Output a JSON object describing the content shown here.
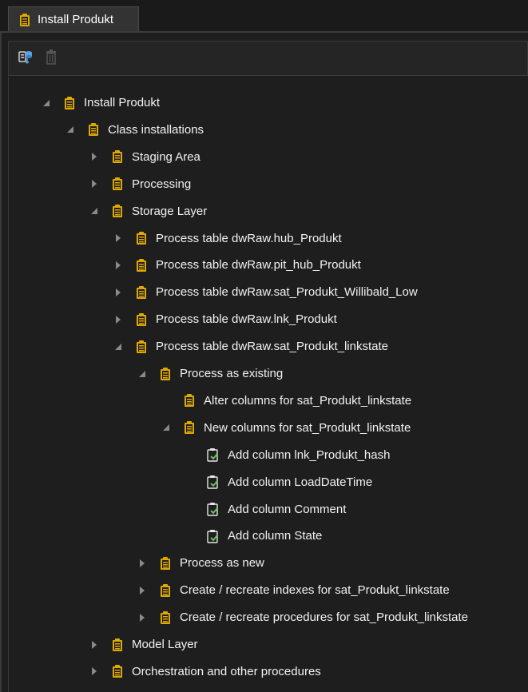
{
  "tab": {
    "title": "Install Produkt"
  },
  "tree": [
    {
      "label": "Install Produkt",
      "level": 0,
      "state": "expanded",
      "icon": "clipboard-icon"
    },
    {
      "label": "Class installations",
      "level": 1,
      "state": "expanded",
      "icon": "clipboard-icon"
    },
    {
      "label": "Staging Area",
      "level": 2,
      "state": "collapsed",
      "icon": "clipboard-icon"
    },
    {
      "label": "Processing",
      "level": 2,
      "state": "collapsed",
      "icon": "clipboard-icon"
    },
    {
      "label": "Storage Layer",
      "level": 2,
      "state": "expanded",
      "icon": "clipboard-icon"
    },
    {
      "label": "Process table dwRaw.hub_Produkt",
      "level": 3,
      "state": "collapsed",
      "icon": "clipboard-icon"
    },
    {
      "label": "Process table dwRaw.pit_hub_Produkt",
      "level": 3,
      "state": "collapsed",
      "icon": "clipboard-icon"
    },
    {
      "label": "Process table dwRaw.sat_Produkt_Willibald_Low",
      "level": 3,
      "state": "collapsed",
      "icon": "clipboard-icon"
    },
    {
      "label": "Process table dwRaw.lnk_Produkt",
      "level": 3,
      "state": "collapsed",
      "icon": "clipboard-icon"
    },
    {
      "label": "Process table dwRaw.sat_Produkt_linkstate",
      "level": 3,
      "state": "expanded",
      "icon": "clipboard-icon"
    },
    {
      "label": "Process as existing",
      "level": 4,
      "state": "expanded",
      "icon": "clipboard-icon"
    },
    {
      "label": "Alter columns for sat_Produkt_linkstate",
      "level": 5,
      "state": "leaf",
      "icon": "clipboard-icon"
    },
    {
      "label": "New columns for sat_Produkt_linkstate",
      "level": 5,
      "state": "expanded",
      "icon": "clipboard-icon"
    },
    {
      "label": "Add column lnk_Produkt_hash",
      "level": 6,
      "state": "leaf",
      "icon": "clipboard-check-icon"
    },
    {
      "label": "Add column LoadDateTime",
      "level": 6,
      "state": "leaf",
      "icon": "clipboard-check-icon"
    },
    {
      "label": "Add column Comment",
      "level": 6,
      "state": "leaf",
      "icon": "clipboard-check-icon"
    },
    {
      "label": "Add column State",
      "level": 6,
      "state": "leaf",
      "icon": "clipboard-check-icon"
    },
    {
      "label": "Process as new",
      "level": 4,
      "state": "collapsed",
      "icon": "clipboard-icon"
    },
    {
      "label": "Create / recreate indexes for sat_Produkt_linkstate",
      "level": 4,
      "state": "collapsed",
      "icon": "clipboard-icon"
    },
    {
      "label": "Create / recreate procedures for sat_Produkt_linkstate",
      "level": 4,
      "state": "collapsed",
      "icon": "clipboard-icon"
    },
    {
      "label": "Model Layer",
      "level": 2,
      "state": "collapsed",
      "icon": "clipboard-icon"
    },
    {
      "label": "Orchestration and other procedures",
      "level": 2,
      "state": "collapsed",
      "icon": "clipboard-icon"
    }
  ],
  "colors": {
    "background": "#1e1e1e",
    "clipboard": "#e0a800",
    "check": "#6bbf59",
    "arrow": "#8a8a8a",
    "toolbar_icon": "#5aa0e6"
  }
}
